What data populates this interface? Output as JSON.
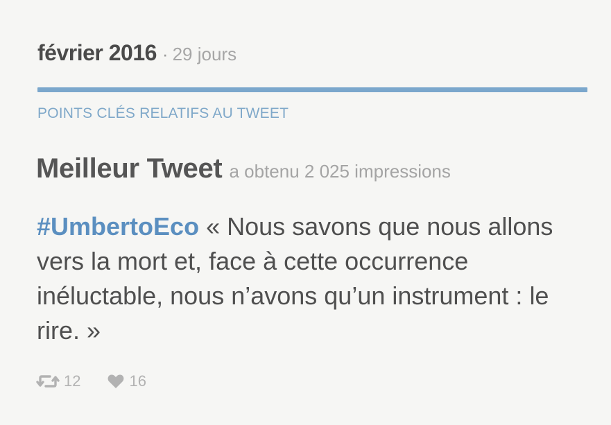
{
  "header": {
    "month": "février 2016",
    "separator": "·",
    "days": "29 jours"
  },
  "section": {
    "label": "POINTS CLÉS RELATIFS AU TWEET"
  },
  "best_tweet": {
    "title": "Meilleur Tweet",
    "impressions": "a obtenu 2 025 impressions",
    "hashtag": "#UmbertoEco",
    "text": " « Nous savons que nous allons vers la mort et, face à cette occurrence inéluctable, nous n’avons qu’un instrument : le rire. »",
    "retweets": "12",
    "likes": "16"
  },
  "icons": {
    "retweet": "retweet-icon",
    "like": "heart-icon"
  },
  "colors": {
    "accent": "#7ba7cc",
    "hashtag": "#5b8fc0",
    "section_label": "#7fa8c9",
    "icon": "#b2b2b2"
  }
}
